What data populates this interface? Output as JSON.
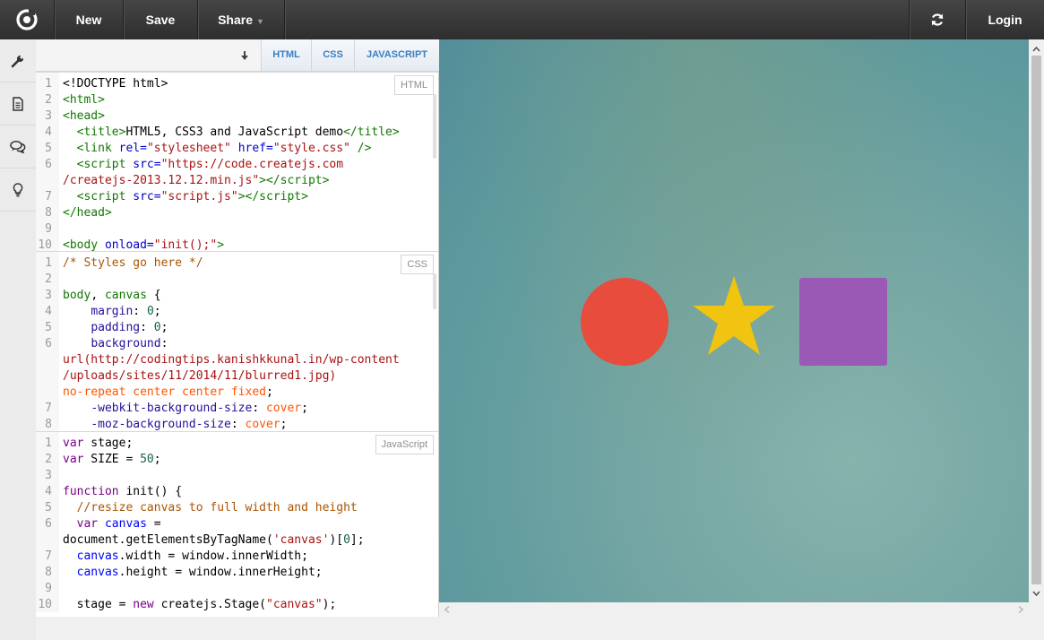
{
  "topbar": {
    "logo_icon": "codepad-logo-icon",
    "new_label": "New",
    "save_label": "Save",
    "share_label": "Share",
    "share_caret": "▼",
    "refresh_icon": "refresh-icon",
    "login_label": "Login"
  },
  "sidebar": {
    "items": [
      {
        "icon": "wrench-icon"
      },
      {
        "icon": "document-icon"
      },
      {
        "icon": "chat-bubbles-icon"
      },
      {
        "icon": "lightbulb-icon"
      }
    ]
  },
  "editor": {
    "collapse_icon": "arrow-down-icon",
    "tabs": [
      {
        "label": "HTML"
      },
      {
        "label": "CSS"
      },
      {
        "label": "JAVASCRIPT"
      }
    ],
    "html_pane": {
      "badge": "HTML",
      "lines": [
        {
          "n": "1",
          "html": "&lt;!DOCTYPE html&gt;"
        },
        {
          "n": "2",
          "html": "<span class=\"tag\">&lt;html&gt;</span>"
        },
        {
          "n": "3",
          "html": "<span class=\"tag\">&lt;head&gt;</span>"
        },
        {
          "n": "4",
          "html": "  <span class=\"tag\">&lt;title&gt;</span>HTML5, CSS3 and JavaScript demo<span class=\"tag\">&lt;/title&gt;</span>"
        },
        {
          "n": "5",
          "html": "  <span class=\"tag\">&lt;link</span> <span class=\"att\">rel=</span><span class=\"str\">\"stylesheet\"</span> <span class=\"att\">href=</span><span class=\"str\">\"style.css\"</span> <span class=\"tag\">/&gt;</span>"
        },
        {
          "n": "6",
          "html": "  <span class=\"tag\">&lt;script</span> <span class=\"att\">src=</span><span class=\"str\">\"https://code.createjs.com</span>"
        },
        {
          "n": "",
          "html": "<span class=\"str\">/createjs-2013.12.12.min.js\"</span><span class=\"tag\">&gt;&lt;/script&gt;</span>"
        },
        {
          "n": "7",
          "html": "  <span class=\"tag\">&lt;script</span> <span class=\"att\">src=</span><span class=\"str\">\"script.js\"</span><span class=\"tag\">&gt;&lt;/script&gt;</span>"
        },
        {
          "n": "8",
          "html": "<span class=\"tag\">&lt;/head&gt;</span>"
        },
        {
          "n": "9",
          "html": ""
        },
        {
          "n": "10",
          "html": "<span class=\"tag\">&lt;body</span> <span class=\"att\">onload=</span><span class=\"str\">\"init();\"</span><span class=\"tag\">&gt;</span>"
        }
      ]
    },
    "css_pane": {
      "badge": "CSS",
      "lines": [
        {
          "n": "1",
          "html": "<span class=\"cm\">/* Styles go here */</span>"
        },
        {
          "n": "2",
          "html": ""
        },
        {
          "n": "3",
          "html": "<span class=\"tag\">body</span>, <span class=\"tag\">canvas</span> {"
        },
        {
          "n": "4",
          "html": "    <span class=\"prop\">margin</span>: <span class=\"num\">0</span>;"
        },
        {
          "n": "5",
          "html": "    <span class=\"prop\">padding</span>: <span class=\"num\">0</span>;"
        },
        {
          "n": "6",
          "html": "    <span class=\"prop\">background</span>:"
        },
        {
          "n": "",
          "html": "<span class=\"str\">url(http://codingtips.kanishkkunal.in/wp-content</span>"
        },
        {
          "n": "",
          "html": "<span class=\"str\">/uploads/sites/11/2014/11/blurred1.jpg)</span>"
        },
        {
          "n": "",
          "html": "<span class=\"kwd\">no-repeat center center fixed</span>;"
        },
        {
          "n": "7",
          "html": "    <span class=\"prop\">-webkit-background-size</span>: <span class=\"kwd\">cover</span>;"
        },
        {
          "n": "8",
          "html": "    <span class=\"prop\">-moz-background-size</span>: <span class=\"kwd\">cover</span>;"
        }
      ]
    },
    "js_pane": {
      "badge": "JavaScript",
      "lines": [
        {
          "n": "1",
          "html": "<span class=\"kw\">var</span> stage;"
        },
        {
          "n": "2",
          "html": "<span class=\"kw\">var</span> SIZE = <span class=\"num\">50</span>;"
        },
        {
          "n": "3",
          "html": ""
        },
        {
          "n": "4",
          "html": "<span class=\"kw\">function</span> init() {"
        },
        {
          "n": "5",
          "html": "  <span class=\"cm\">//resize canvas to full width and height</span>"
        },
        {
          "n": "6",
          "html": "  <span class=\"kw\">var</span> <span class=\"var\">canvas</span> ="
        },
        {
          "n": "",
          "html": "document.getElementsByTagName(<span class=\"str\">'canvas'</span>)[<span class=\"num\">0</span>];"
        },
        {
          "n": "7",
          "html": "  <span class=\"var\">canvas</span>.width = window.innerWidth;"
        },
        {
          "n": "8",
          "html": "  <span class=\"var\">canvas</span>.height = window.innerHeight;"
        },
        {
          "n": "9",
          "html": ""
        },
        {
          "n": "10",
          "html": "  stage = <span class=\"kw\">new</span> createjs.Stage(<span class=\"str\">\"canvas\"</span>);"
        }
      ]
    }
  },
  "preview": {
    "shapes": [
      {
        "name": "red-circle",
        "color": "#e74c3c"
      },
      {
        "name": "yellow-star",
        "color": "#f1c40f"
      },
      {
        "name": "purple-square",
        "color": "#9b59b6"
      }
    ]
  }
}
